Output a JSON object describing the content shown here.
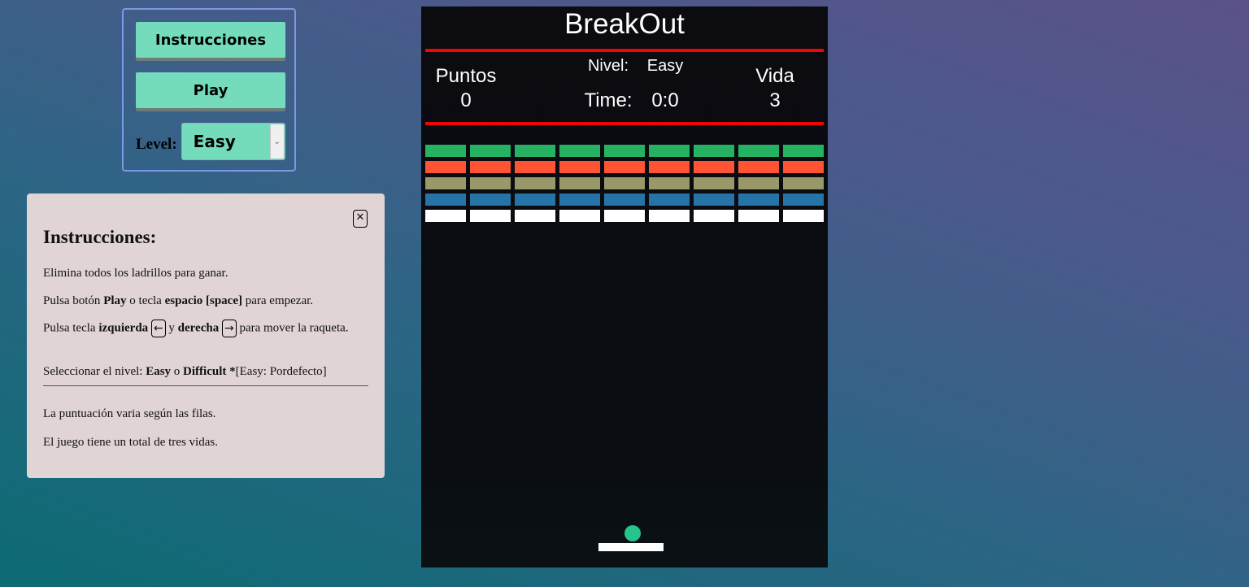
{
  "controls": {
    "instructions_label": "Instrucciones",
    "play_label": "Play",
    "level_label": "Level:",
    "level_value": "Easy",
    "accent": "#74dcbd"
  },
  "instructions": {
    "title": "Instrucciones:",
    "close_icon": "close-icon",
    "p1": "Elimina todos los ladrillos para ganar.",
    "p2_a": "Pulsa botón ",
    "p2_b": "Play",
    "p2_c": " o tecla ",
    "p2_d": "espacio [space]",
    "p2_e": " para empezar.",
    "p3_a": "Pulsa tecla ",
    "p3_b": "izquierda",
    "p3_key_left": "←",
    "p3_c": " y ",
    "p3_d": "derecha",
    "p3_key_right": "→",
    "p3_e": " para mover la raqueta.",
    "p4_a": "Seleccionar el nivel: ",
    "p4_b": "Easy",
    "p4_c": " o ",
    "p4_d": "Difficult",
    "p4_e": " *",
    "p4_f": "[Easy: Pordefecto]",
    "p5": "La puntuación varia según las filas.",
    "p6": "El juego tiene un total de tres vidas."
  },
  "game": {
    "title": "BreakOut",
    "points_label": "Puntos",
    "points_value": "0",
    "level_label": "Nivel:",
    "level_value": "Easy",
    "time_label": "Time:",
    "time_value": "0:0",
    "lives_label": "Vida",
    "lives_value": "3",
    "brick_columns": 9,
    "brick_row_colors": [
      "#25b262",
      "#ff5433",
      "#989868",
      "#2673a8",
      "#ffffff"
    ],
    "ball_color": "#26c38c",
    "line_color": "#f00505"
  }
}
